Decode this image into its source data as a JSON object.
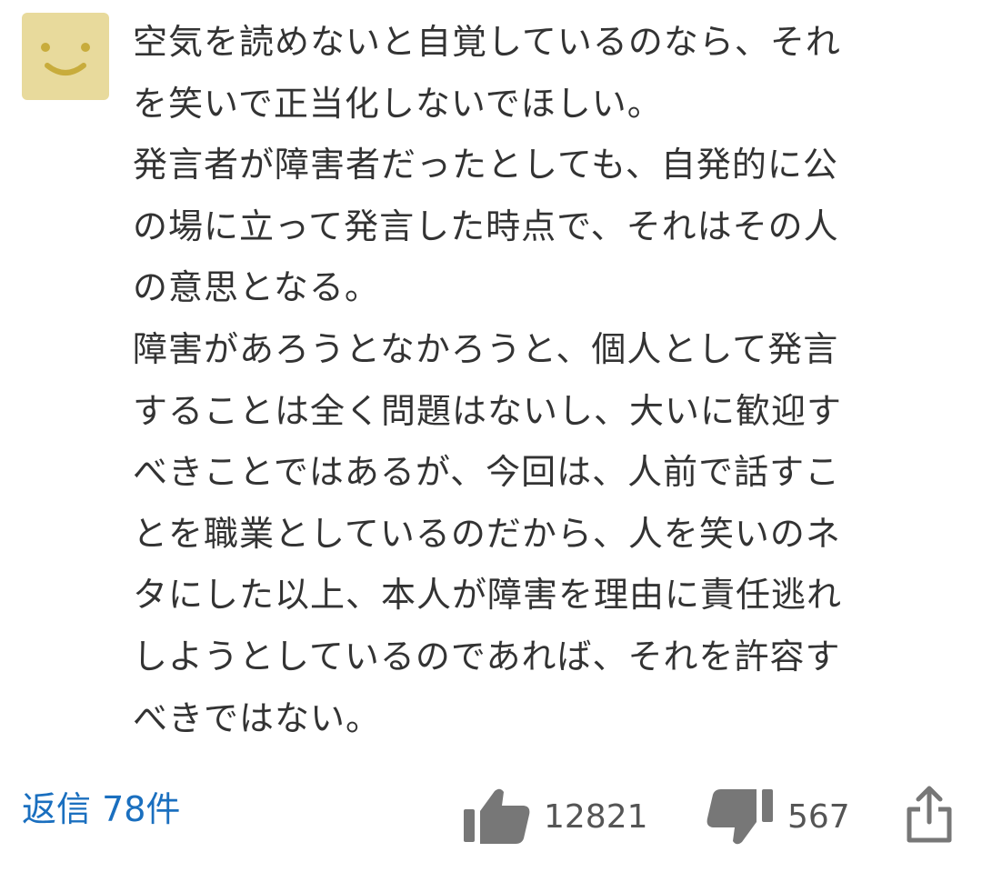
{
  "comment": {
    "avatar_icon": "smiley-face-icon",
    "avatar_color": "#e8da9c",
    "lines": [
      "空気を読めないと自覚しているのなら、それ",
      "を笑いで正当化しないでほしい。",
      "発言者が障害者だったとしても、自発的に公",
      "の場に立って発言した時点で、それはその人",
      "の意思となる。",
      "障害があろうとなかろうと、個人として発言",
      "することは全く問題はないし、大いに歓迎す",
      "べきことではあるが、今回は、人前で話すこ",
      "とを職業としているのだから、人を笑いのネ",
      "タにした以上、本人が障害を理由に責任逃れ",
      "しようとしているのであれば、それを許容す",
      "べきではない。"
    ]
  },
  "actions": {
    "reply_label": "返信 78件",
    "good_icon": "thumbs-up-icon",
    "good_count": "12821",
    "bad_icon": "thumbs-down-icon",
    "bad_count": "567",
    "share_icon": "share-icon",
    "link_color": "#1a6fbf"
  }
}
